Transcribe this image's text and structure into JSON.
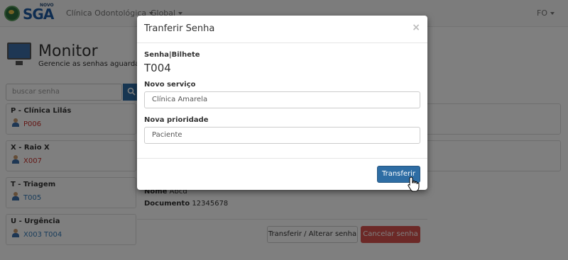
{
  "navbar": {
    "logo_small": "NOVO",
    "logo_text": "SGA",
    "unit_menu": "Clínica Odontológica",
    "global_menu": "Global",
    "user_menu": "FO"
  },
  "header": {
    "title": "Monitor",
    "subtitle": "Gerencie as senhas aguardando"
  },
  "search": {
    "placeholder": "buscar senha",
    "button_icon": "search-icon"
  },
  "queues": [
    {
      "title": "P - Clínica Lilás",
      "tickets": [
        "P006"
      ],
      "ticket_color": "#c9302c"
    },
    {
      "title": "X - Raio X",
      "tickets": [
        "X007"
      ],
      "ticket_color": "#c9302c"
    },
    {
      "title": "T - Triagem",
      "tickets": [
        "T005"
      ],
      "ticket_color": "#337ab7"
    },
    {
      "title": "U - Urgência",
      "tickets": [
        "X003",
        "T004"
      ],
      "ticket_color": "#337ab7"
    }
  ],
  "details": {
    "name_label": "Nome",
    "name_value": "Abcd",
    "document_label": "Documento",
    "document_value": "12345678",
    "transfer_button": "Transferir / Alterar senha",
    "cancel_button": "Cancelar senha"
  },
  "modal": {
    "title": "Tranferir Senha",
    "close": "×",
    "ticket_label": "Senha|Bilhete",
    "ticket_value": "T004",
    "service_label": "Novo serviço",
    "service_value": "Clínica Amarela",
    "priority_label": "Nova prioridade",
    "priority_value": "Paciente",
    "submit_button": "Transferir"
  },
  "colors": {
    "primary": "#2e6da4",
    "danger": "#d9534f"
  }
}
